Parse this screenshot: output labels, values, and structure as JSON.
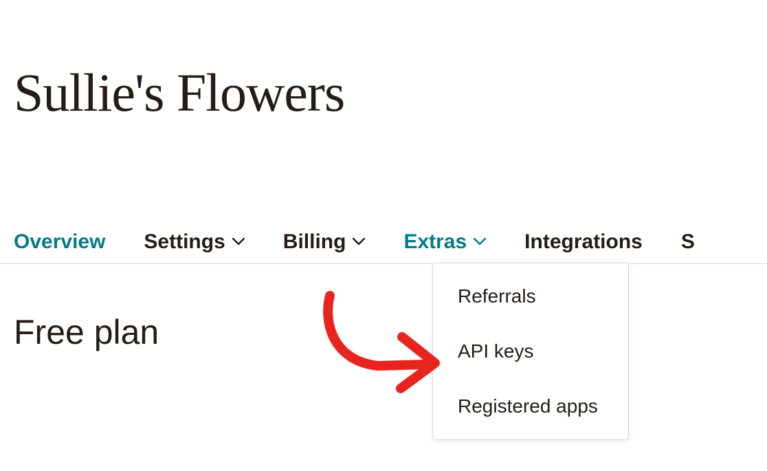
{
  "page": {
    "title": "Sullie's Flowers",
    "plan_label": "Free plan"
  },
  "nav": {
    "items": [
      {
        "label": "Overview",
        "has_dropdown": false,
        "active": true
      },
      {
        "label": "Settings",
        "has_dropdown": true,
        "active": false
      },
      {
        "label": "Billing",
        "has_dropdown": true,
        "active": false
      },
      {
        "label": "Extras",
        "has_dropdown": true,
        "active": true
      },
      {
        "label": "Integrations",
        "has_dropdown": false,
        "active": false
      },
      {
        "label": "S",
        "has_dropdown": false,
        "active": false
      }
    ]
  },
  "dropdown": {
    "items": [
      {
        "label": "Referrals"
      },
      {
        "label": "API keys"
      },
      {
        "label": "Registered apps"
      }
    ]
  },
  "colors": {
    "accent": "#007c89",
    "text": "#241c15",
    "border": "#d9d9d9",
    "annotation": "#e8241f"
  }
}
